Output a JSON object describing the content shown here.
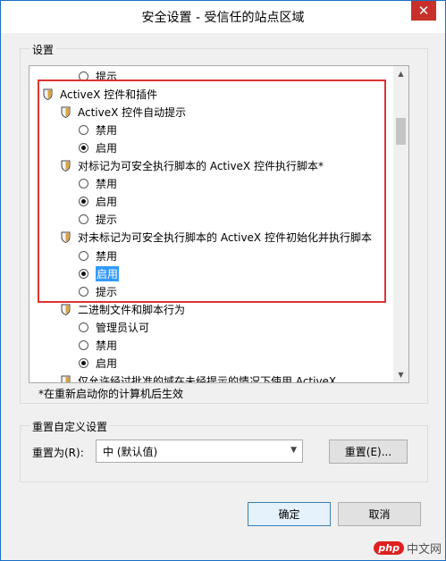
{
  "window": {
    "title": "安全设置 - 受信任的站点区域",
    "close_icon": "close-icon"
  },
  "settings": {
    "label": "设置",
    "items": [
      {
        "type": "option",
        "label": "提示",
        "checked": false,
        "indent": 2
      },
      {
        "type": "category",
        "label": "ActiveX 控件和插件",
        "indent": 0
      },
      {
        "type": "setting",
        "label": "ActiveX 控件自动提示",
        "indent": 1
      },
      {
        "type": "option",
        "label": "禁用",
        "checked": false,
        "indent": 2
      },
      {
        "type": "option",
        "label": "启用",
        "checked": true,
        "indent": 2
      },
      {
        "type": "setting",
        "label": "对标记为可安全执行脚本的 ActiveX 控件执行脚本*",
        "indent": 1
      },
      {
        "type": "option",
        "label": "禁用",
        "checked": false,
        "indent": 2
      },
      {
        "type": "option",
        "label": "启用",
        "checked": true,
        "indent": 2
      },
      {
        "type": "option",
        "label": "提示",
        "checked": false,
        "indent": 2
      },
      {
        "type": "setting",
        "label": "对未标记为可安全执行脚本的 ActiveX 控件初始化并执行脚本",
        "indent": 1
      },
      {
        "type": "option",
        "label": "禁用",
        "checked": false,
        "indent": 2
      },
      {
        "type": "option",
        "label": "启用",
        "checked": true,
        "indent": 2,
        "selected": true
      },
      {
        "type": "option",
        "label": "提示",
        "checked": false,
        "indent": 2
      },
      {
        "type": "setting",
        "label": "二进制文件和脚本行为",
        "indent": 1
      },
      {
        "type": "option",
        "label": "管理员认可",
        "checked": false,
        "indent": 2
      },
      {
        "type": "option",
        "label": "禁用",
        "checked": false,
        "indent": 2
      },
      {
        "type": "option",
        "label": "启用",
        "checked": true,
        "indent": 2
      },
      {
        "type": "setting",
        "label": "仅允许经过批准的域在未经提示的情况下使用 ActiveX",
        "indent": 1
      }
    ],
    "note": "*在重新启动你的计算机后生效"
  },
  "reset": {
    "label": "重置自定义设置",
    "reset_to_label": "重置为(R):",
    "reset_to_value": "中 (默认值)",
    "reset_button": "重置(E)..."
  },
  "buttons": {
    "ok": "确定",
    "cancel": "取消"
  },
  "watermark": {
    "logo": "php",
    "text": "中文网"
  },
  "colors": {
    "accent": "#1a6fc4",
    "highlight": "#3399ff",
    "annotation": "#dd3333",
    "close": "#c7312a"
  }
}
